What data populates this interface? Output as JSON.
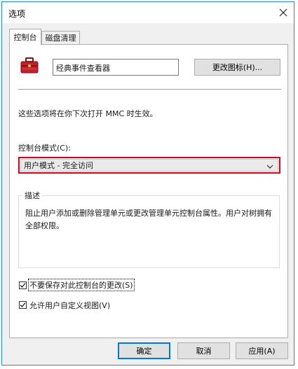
{
  "window": {
    "title": "选项"
  },
  "tabs": [
    {
      "label": "控制台"
    },
    {
      "label": "磁盘清理"
    }
  ],
  "console": {
    "name_value": "经典事件查看器",
    "change_icon_label": "更改图标(H)...",
    "info_text": "这些选项将在你下次打开 MMC 时生效。",
    "mode_label": "控制台模式(C):",
    "mode_selected": "用户模式 - 完全访问",
    "description_title": "描述",
    "description_text": "阻止用户添加或删除管理单元或更改管理单元控制台属性。用户对树拥有全部权限。",
    "checkbox_no_save_label": "不要保存对此控制台的更改(S)",
    "checkbox_no_save_checked": true,
    "checkbox_allow_custom_label": "允许用户自定义视图(V)",
    "checkbox_allow_custom_checked": true
  },
  "buttons": {
    "ok": "确定",
    "cancel": "取消",
    "apply": "应用(A)"
  },
  "colors": {
    "highlight_border": "#d9001b",
    "window_border": "#1a8ae0",
    "default_button_border": "#0078d7"
  },
  "icons": {
    "console_icon": "red-toolbox-icon",
    "close": "close-icon",
    "dropdown": "chevron-down-icon",
    "check": "checkmark-icon"
  }
}
